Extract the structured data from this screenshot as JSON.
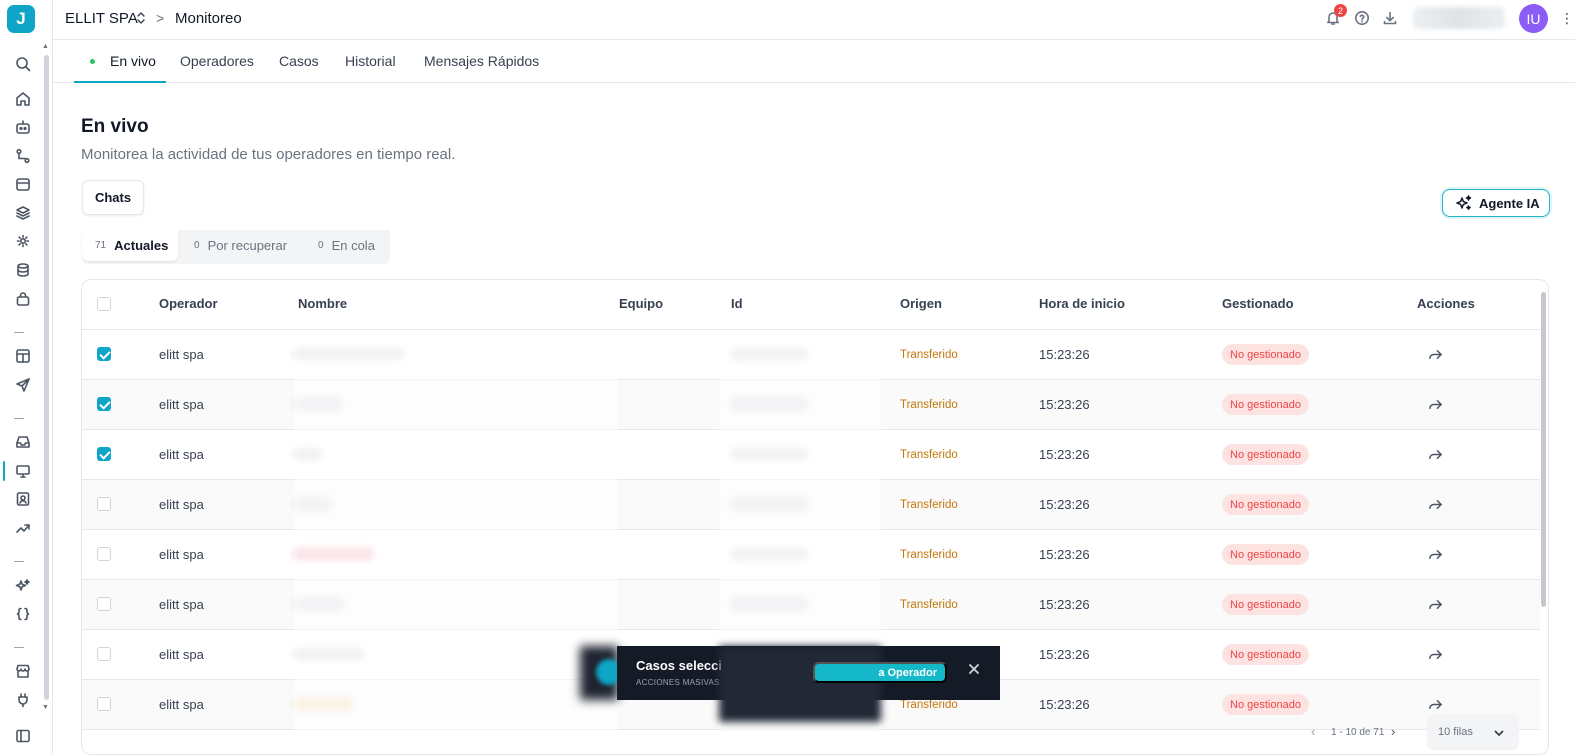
{
  "app": {
    "logo_letter": "J"
  },
  "header": {
    "org_name": "ELLIT SPA",
    "crumb_separator": ">",
    "section": "Monitoreo",
    "notifications_count": "2",
    "avatar_initials": "IU",
    "more": "⋮"
  },
  "tabs": [
    {
      "label": "En vivo",
      "active": true
    },
    {
      "label": "Operadores"
    },
    {
      "label": "Casos"
    },
    {
      "label": "Historial"
    },
    {
      "label": "Mensajes Rápidos"
    }
  ],
  "page": {
    "title": "En vivo",
    "subtitle": "Monitorea la actividad de tus operadores en tiempo real.",
    "chats_button": "Chats",
    "agent_button": "Agente IA"
  },
  "segments": [
    {
      "count": "71",
      "label": "Actuales",
      "active": true
    },
    {
      "count": "0",
      "label": "Por recuperar"
    },
    {
      "count": "0",
      "label": "En cola"
    }
  ],
  "table": {
    "columns": [
      "Operador",
      "Nombre",
      "Equipo",
      "Id",
      "Origen",
      "Hora de inicio",
      "Gestionado",
      "Acciones"
    ],
    "rows": [
      {
        "checked": true,
        "operator": "elitt spa",
        "origin": "Transferido",
        "start": "15:23:26",
        "status": "No gestionado"
      },
      {
        "checked": true,
        "operator": "elitt spa",
        "origin": "Transferido",
        "start": "15:23:26",
        "status": "No gestionado"
      },
      {
        "checked": true,
        "operator": "elitt spa",
        "origin": "Transferido",
        "start": "15:23:26",
        "status": "No gestionado"
      },
      {
        "checked": false,
        "operator": "elitt spa",
        "origin": "Transferido",
        "start": "15:23:26",
        "status": "No gestionado"
      },
      {
        "checked": false,
        "operator": "elitt spa",
        "origin": "Transferido",
        "start": "15:23:26",
        "status": "No gestionado"
      },
      {
        "checked": false,
        "operator": "elitt spa",
        "origin": "Transferido",
        "start": "15:23:26",
        "status": "No gestionado"
      },
      {
        "checked": false,
        "operator": "elitt spa",
        "origin": "",
        "start": "15:23:26",
        "status": "No gestionado"
      },
      {
        "checked": false,
        "operator": "elitt spa",
        "origin": "Transferido",
        "start": "15:23:26",
        "status": "No gestionado"
      }
    ]
  },
  "bulk_bar": {
    "title": "Casos selecci",
    "subtitle": "ACCIONES MASIVAS",
    "action_label": "a Operador"
  },
  "pagination": {
    "prev": "‹",
    "range": "1 - 10 de 71",
    "next": "›",
    "rows_per_page": "10 filas"
  },
  "colors": {
    "accent": "#0ea5c6",
    "origin_text": "#c2780b",
    "status_badge_bg": "#fde2e2",
    "status_badge_text": "#ef4444",
    "avatar": "#8b5cf6",
    "bulk_bar_bg": "#141a26"
  },
  "icons": {
    "sidebar": [
      "search-icon",
      "home-icon",
      "bot-icon",
      "flow-icon",
      "archive-icon",
      "layers-icon",
      "gear-icon",
      "database-icon",
      "bag-icon",
      "template-icon",
      "send-icon",
      "inbox-icon",
      "monitor-icon",
      "contact-icon",
      "trend-icon",
      "sparkles-icon",
      "braces-icon",
      "store-icon",
      "plug-icon",
      "panel-icon"
    ],
    "header": [
      "bell-icon",
      "help-icon",
      "download-icon"
    ],
    "row_action": "forward-arrow-icon"
  }
}
